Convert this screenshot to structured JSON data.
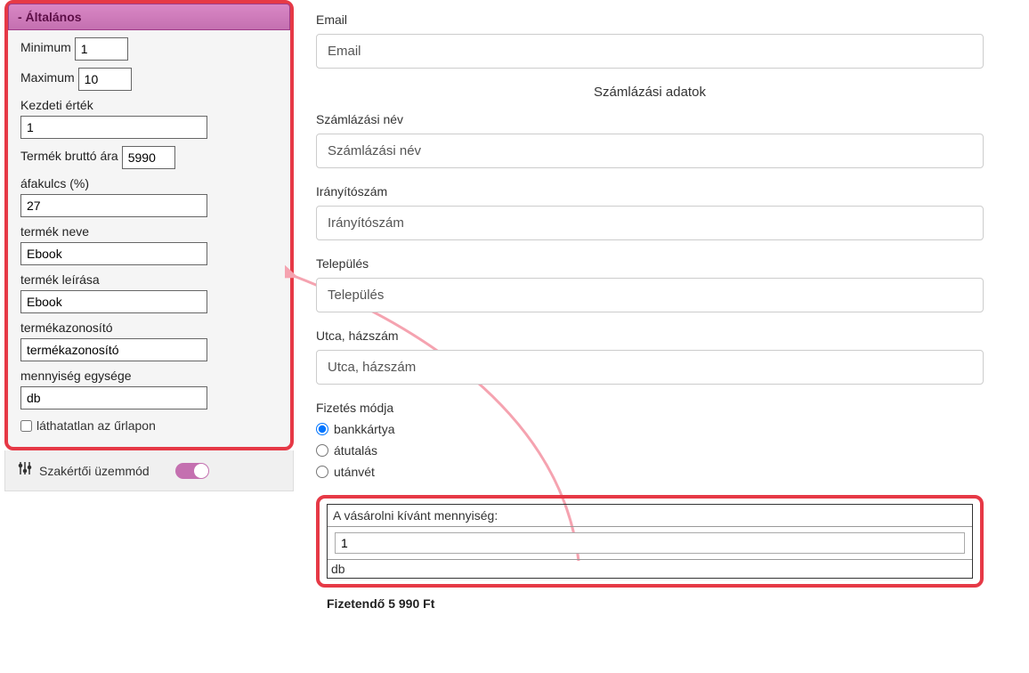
{
  "sidebar": {
    "header": "- Általános",
    "fields": {
      "minimum": {
        "label": "Minimum",
        "value": "1"
      },
      "maximum": {
        "label": "Maximum",
        "value": "10"
      },
      "initial": {
        "label": "Kezdeti érték",
        "value": "1"
      },
      "gross_price": {
        "label": "Termék bruttó ára",
        "value": "5990"
      },
      "vat": {
        "label": "áfakulcs (%)",
        "value": "27"
      },
      "product_name": {
        "label": "termék neve",
        "value": "Ebook"
      },
      "product_desc": {
        "label": "termék leírása",
        "value": "Ebook"
      },
      "product_id": {
        "label": "termékazonosító",
        "value": "termékazonosító"
      },
      "unit": {
        "label": "mennyiség egysége",
        "value": "db"
      },
      "invisible": {
        "label": "láthatatlan az űrlapon"
      }
    },
    "expert": {
      "label": "Szakértői üzemmód"
    }
  },
  "form": {
    "email": {
      "label": "Email",
      "placeholder": "Email"
    },
    "billing_heading": "Számlázási adatok",
    "billing_name": {
      "label": "Számlázási név",
      "placeholder": "Számlázási név"
    },
    "zip": {
      "label": "Irányítószám",
      "placeholder": "Irányítószám"
    },
    "city": {
      "label": "Település",
      "placeholder": "Település"
    },
    "street": {
      "label": "Utca, házszám",
      "placeholder": "Utca, házszám"
    },
    "payment": {
      "label": "Fizetés módja",
      "options": {
        "card": "bankkártya",
        "transfer": "átutalás",
        "cod": "utánvét"
      }
    },
    "quantity": {
      "label": "A vásárolni kívánt mennyiség:",
      "value": "1",
      "unit": "db"
    },
    "total": "Fizetendő 5 990 Ft"
  }
}
